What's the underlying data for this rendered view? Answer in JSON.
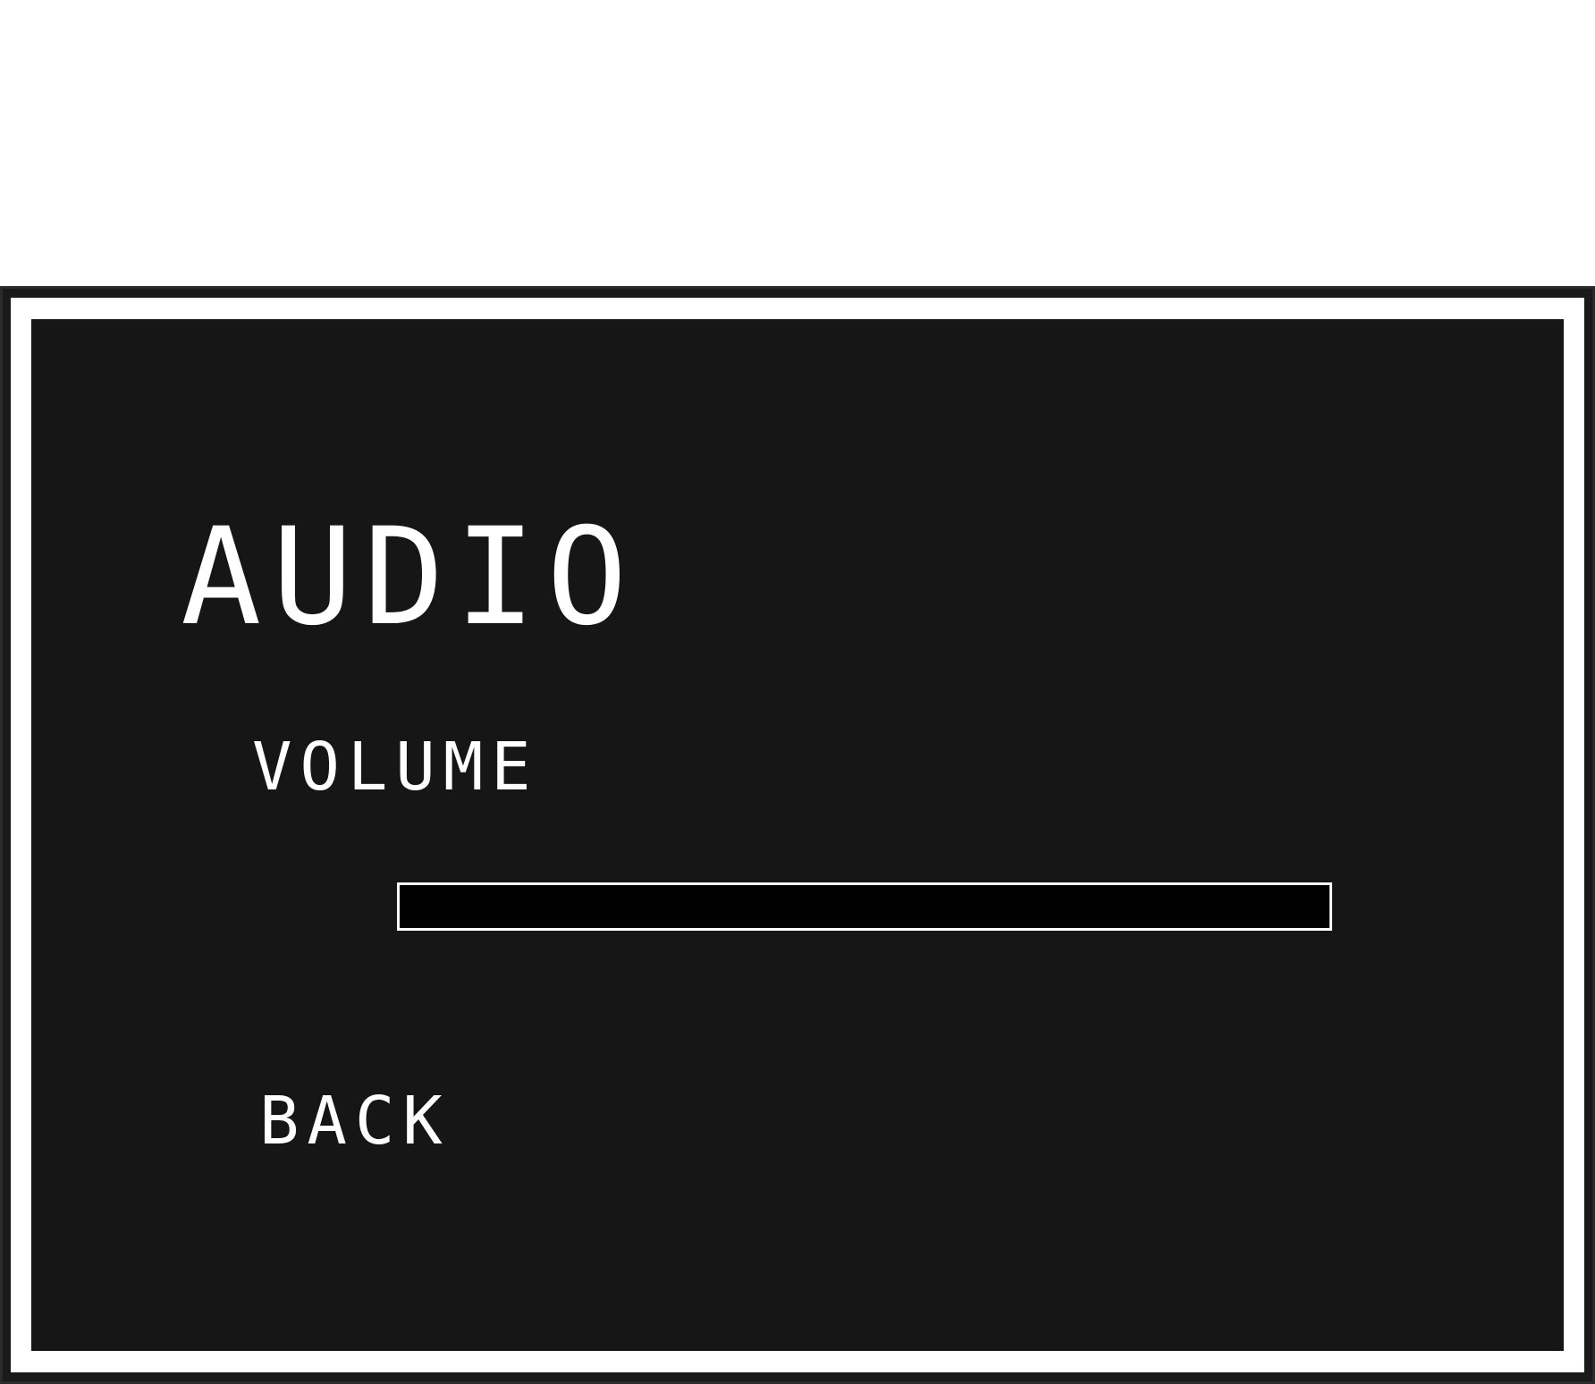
{
  "menu": {
    "title": "AUDIO",
    "volume_label": "VOLUME",
    "volume_level": 0,
    "back_label": "BACK"
  },
  "colors": {
    "background": "#161616",
    "frame": "#ffffff",
    "text": "#ffffff",
    "bar_track": "#000000",
    "bar_fill": "#ffffff"
  }
}
